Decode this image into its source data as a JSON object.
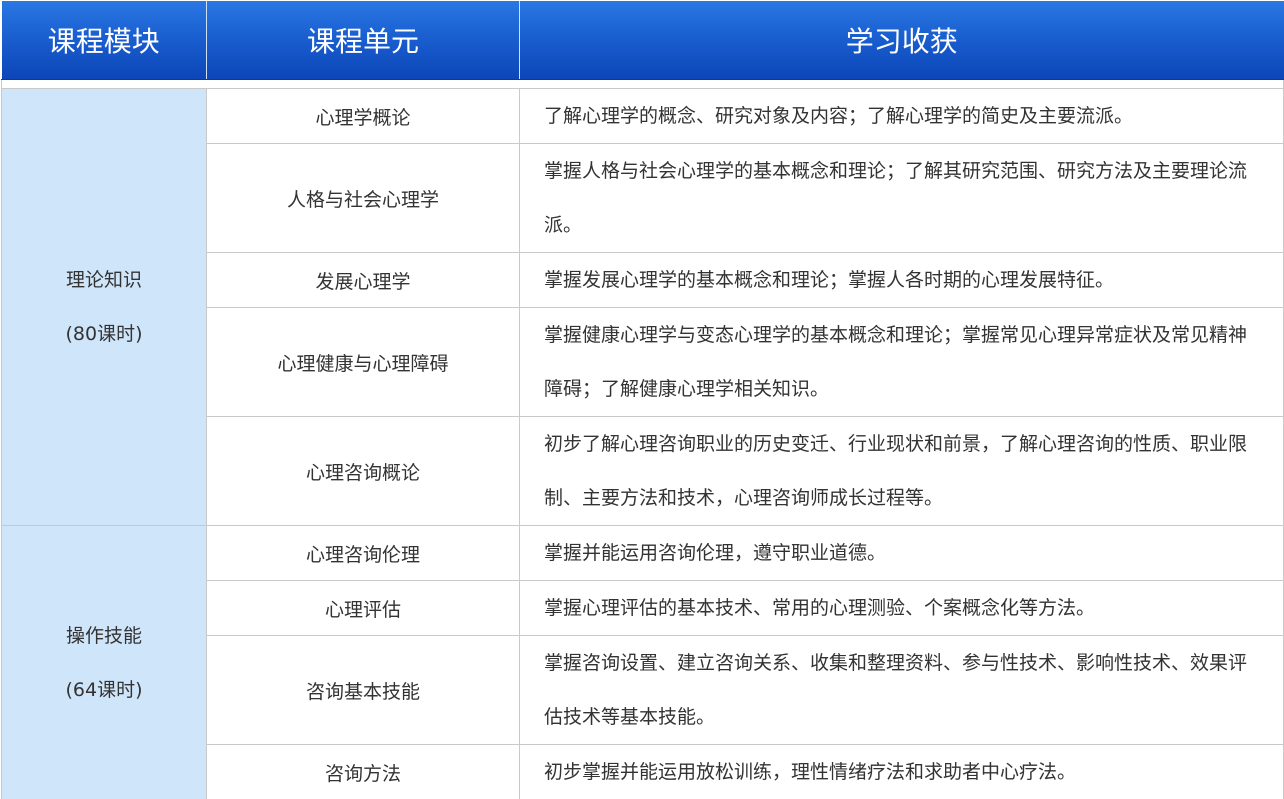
{
  "header": {
    "col1": "课程模块",
    "col2": "课程单元",
    "col3": "学习收获"
  },
  "modules": [
    {
      "name": "理论知识",
      "hours": "(80课时)",
      "units": [
        {
          "unit": "心理学概论",
          "gain": "了解心理学的概念、研究对象及内容；了解心理学的简史及主要流派。"
        },
        {
          "unit": "人格与社会心理学",
          "gain": "掌握人格与社会心理学的基本概念和理论；了解其研究范围、研究方法及主要理论流派。"
        },
        {
          "unit": "发展心理学",
          "gain": "掌握发展心理学的基本概念和理论；掌握人各时期的心理发展特征。"
        },
        {
          "unit": "心理健康与心理障碍",
          "gain": "掌握健康心理学与变态心理学的基本概念和理论；掌握常见心理异常症状及常见精神障碍；了解健康心理学相关知识。"
        },
        {
          "unit": "心理咨询概论",
          "gain": "初步了解心理咨询职业的历史变迁、行业现状和前景，了解心理咨询的性质、职业限制、主要方法和技术，心理咨询师成长过程等。"
        }
      ]
    },
    {
      "name": "操作技能",
      "hours": "(64课时)",
      "units": [
        {
          "unit": "心理咨询伦理",
          "gain": "掌握并能运用咨询伦理，遵守职业道德。"
        },
        {
          "unit": "心理评估",
          "gain": "掌握心理评估的基本技术、常用的心理测验、个案概念化等方法。"
        },
        {
          "unit": "咨询基本技能",
          "gain": "掌握咨询设置、建立咨询关系、收集和整理资料、参与性技术、影响性技术、效果评估技术等基本技能。"
        },
        {
          "unit": "咨询方法",
          "gain": "初步掌握并能运用放松训练，理性情绪疗法和求助者中心疗法。"
        }
      ]
    }
  ],
  "colors": {
    "header_bg": "#1a5fd0",
    "module_bg": "#cfe5fa",
    "border": "#c9c9c9",
    "text": "#333333"
  }
}
